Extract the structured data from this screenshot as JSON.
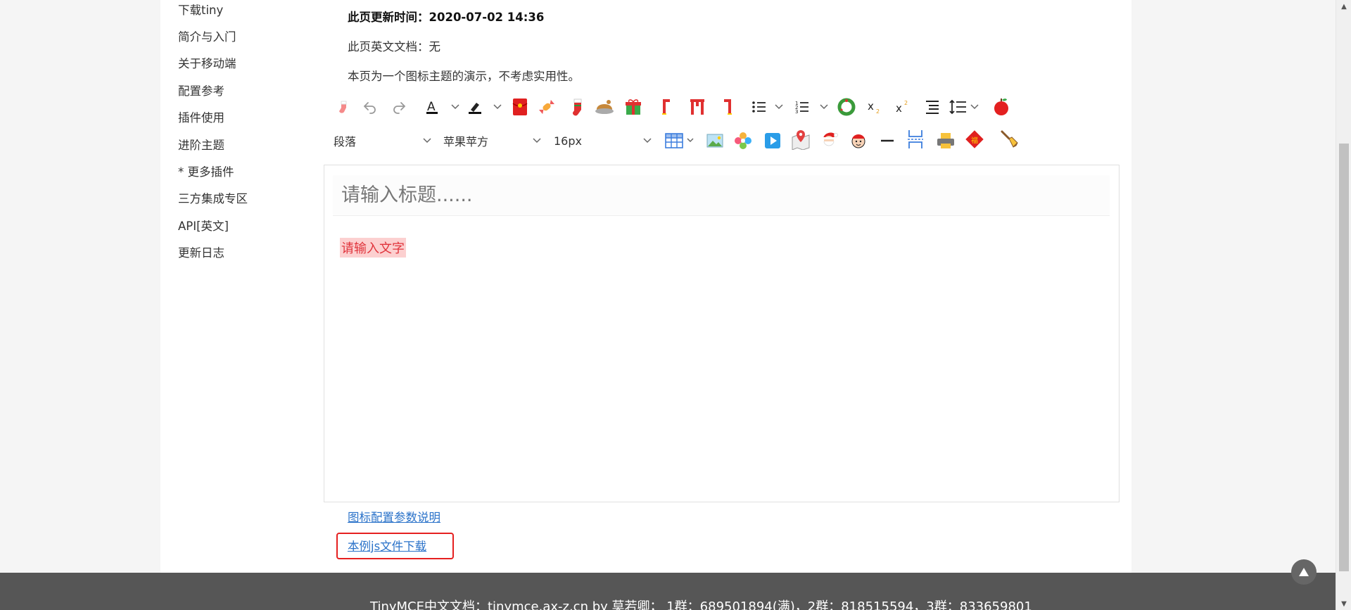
{
  "sidebar": {
    "items": [
      {
        "label": "下载tiny"
      },
      {
        "label": "简介与入门"
      },
      {
        "label": "关于移动端"
      },
      {
        "label": "配置参考"
      },
      {
        "label": "插件使用"
      },
      {
        "label": "进阶主题"
      },
      {
        "label": "* 更多插件"
      },
      {
        "label": "三方集成专区"
      },
      {
        "label": "API[英文]"
      },
      {
        "label": "更新日志"
      }
    ]
  },
  "meta": {
    "updated": "此页更新时间：2020-07-02 14:36",
    "english_doc": "此页英文文档：无",
    "description": "本页为一个图标主题的演示，不考虑实用性。"
  },
  "toolbar": {
    "block_format": "段落",
    "font_family": "苹果苹方",
    "font_size": "16px"
  },
  "editor": {
    "title_placeholder": "请输入标题......",
    "body_text": "请输入文字"
  },
  "links": {
    "icon_config": "图标配置参数说明",
    "js_download": "本例js文件下载"
  },
  "footer": {
    "text": "TinyMCE中文文档：tinymce.ax-z.cn by 莫若卿； 1群：689501894(满)，2群：818515594，3群：833659801"
  },
  "colors": {
    "link": "#2a72c9",
    "highlight_border": "#e52020",
    "body_text_color": "#e0343c",
    "body_text_bg": "#fcd0d0",
    "footer_bg": "#565656"
  },
  "icons": [
    "sock-icon",
    "undo-icon",
    "redo-icon",
    "text-color-icon",
    "highlight-icon",
    "red-envelope-icon",
    "candy-icon",
    "stocking-icon",
    "turkey-icon",
    "gift-icon",
    "align-left-icon",
    "align-center-icon",
    "align-right-icon",
    "bullet-list-icon",
    "numbered-list-icon",
    "wreath-icon",
    "subscript-icon",
    "superscript-icon",
    "indent-icon",
    "line-height-icon",
    "apple-icon",
    "table-icon",
    "image-icon",
    "pinwheel-icon",
    "media-icon",
    "map-icon",
    "santa-icon",
    "elf-icon",
    "hr-icon",
    "page-break-icon",
    "print-icon",
    "fu-charm-icon",
    "paintbrush-icon",
    "back-to-top-icon"
  ]
}
